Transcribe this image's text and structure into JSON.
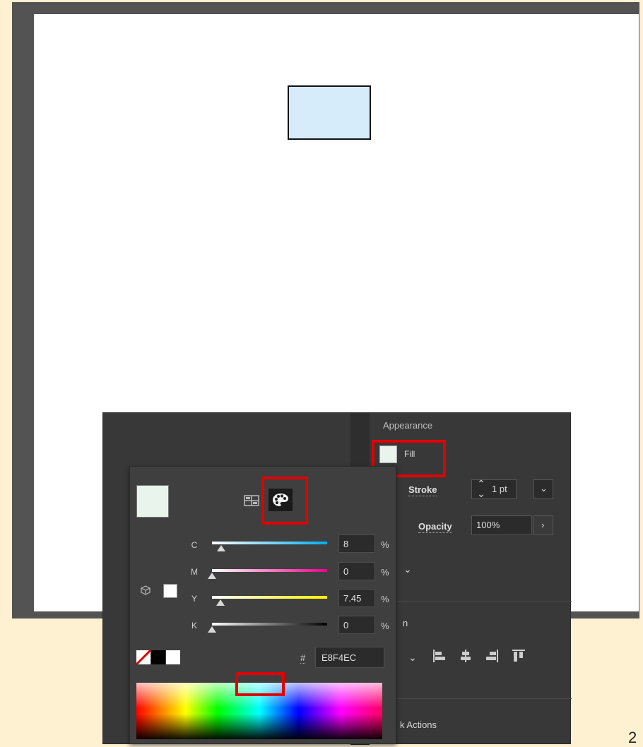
{
  "canvas": {
    "shape_fill": "#d7ecfb"
  },
  "appearance": {
    "header": "Appearance",
    "fill_label": "Fill",
    "fill_color": "#e8f4ec",
    "stroke_label": "Stroke",
    "stroke_value": "1 pt",
    "opacity_label": "Opacity",
    "opacity_value": "100%",
    "align_label_partial": "n",
    "quick_actions_partial": "k Actions"
  },
  "color_picker": {
    "current_color": "#e8f4ec",
    "modes": [
      "swatches",
      "color-mixer"
    ],
    "channels": [
      {
        "label": "C",
        "value": "8",
        "unit": "%",
        "level": 0.08
      },
      {
        "label": "M",
        "value": "0",
        "unit": "%",
        "level": 0
      },
      {
        "label": "Y",
        "value": "7.45",
        "unit": "%",
        "level": 0.0745
      },
      {
        "label": "K",
        "value": "0",
        "unit": "%",
        "level": 0
      }
    ],
    "hex_symbol": "#",
    "hex_value": "E8F4EC"
  },
  "page_number": "2",
  "highlight_color": "#e00000"
}
